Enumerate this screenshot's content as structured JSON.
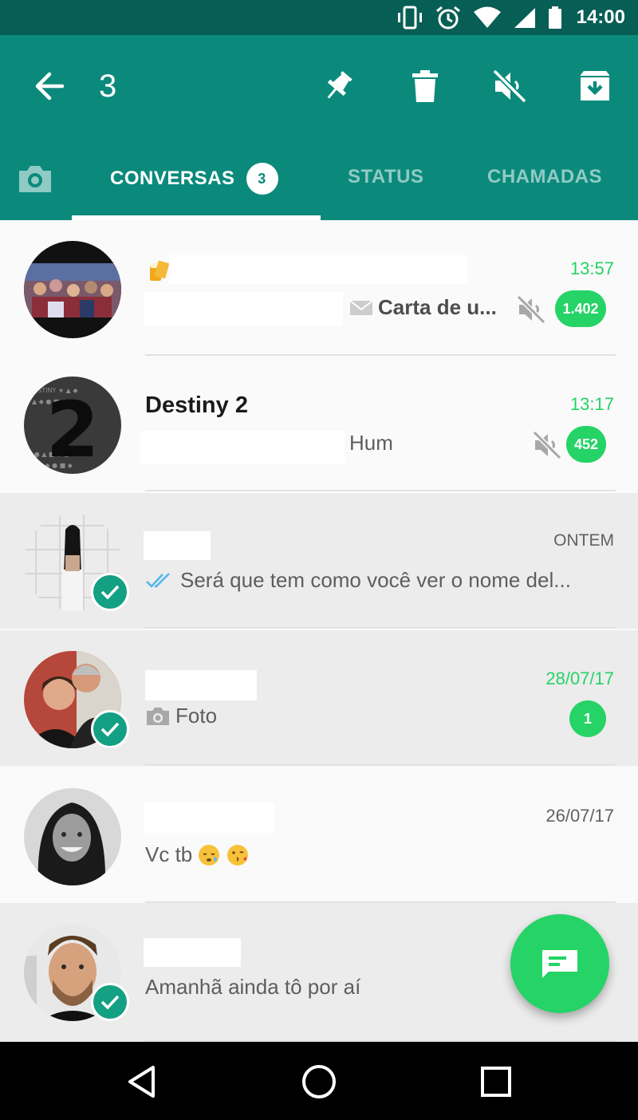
{
  "status_bar": {
    "time": "14:00",
    "icons": [
      "vibrate-icon",
      "alarm-icon",
      "wifi-icon",
      "signal-icon",
      "battery-icon"
    ]
  },
  "toolbar": {
    "selected_count": "3",
    "actions": [
      "back-arrow-icon",
      "pin-icon",
      "delete-icon",
      "mute-icon",
      "archive-icon"
    ]
  },
  "tabs": {
    "camera_icon": "camera-icon",
    "conversas": {
      "label": "CONVERSAS",
      "badge": "3"
    },
    "status": {
      "label": "STATUS"
    },
    "chamadas": {
      "label": "CHAMADAS"
    }
  },
  "chats": [
    {
      "name": "",
      "time": "13:57",
      "preview": "Carta de u...",
      "unread": "1.402",
      "muted": true,
      "selected": false
    },
    {
      "name": "Destiny 2",
      "time": "13:17",
      "preview": "Hum",
      "unread": "452",
      "muted": true,
      "selected": false
    },
    {
      "name": "",
      "time": "ONTEM",
      "preview": "Será que tem como você ver o nome del...",
      "read_receipt": "double-check-icon",
      "selected": true
    },
    {
      "name": "",
      "time": "28/07/17",
      "preview": "Foto",
      "unread": "1",
      "preview_icon": "camera-icon",
      "selected": true
    },
    {
      "name": "",
      "time": "26/07/17",
      "preview": "Vc tb",
      "emoji": [
        "sleepy-face-icon",
        "kissing-face-icon"
      ],
      "selected": false
    },
    {
      "name": "",
      "time": "",
      "preview": "Amanhã ainda tô por aí",
      "selected": true
    }
  ],
  "fab": {
    "icon": "new-chat-icon"
  },
  "nav": [
    "back-triangle-icon",
    "home-circle-icon",
    "recents-square-icon"
  ],
  "colors": {
    "header": "#0b8a7c",
    "status_bar": "#075e54",
    "accent_green": "#25d366",
    "selection_check": "#14a083",
    "selected_row": "#ececec"
  }
}
